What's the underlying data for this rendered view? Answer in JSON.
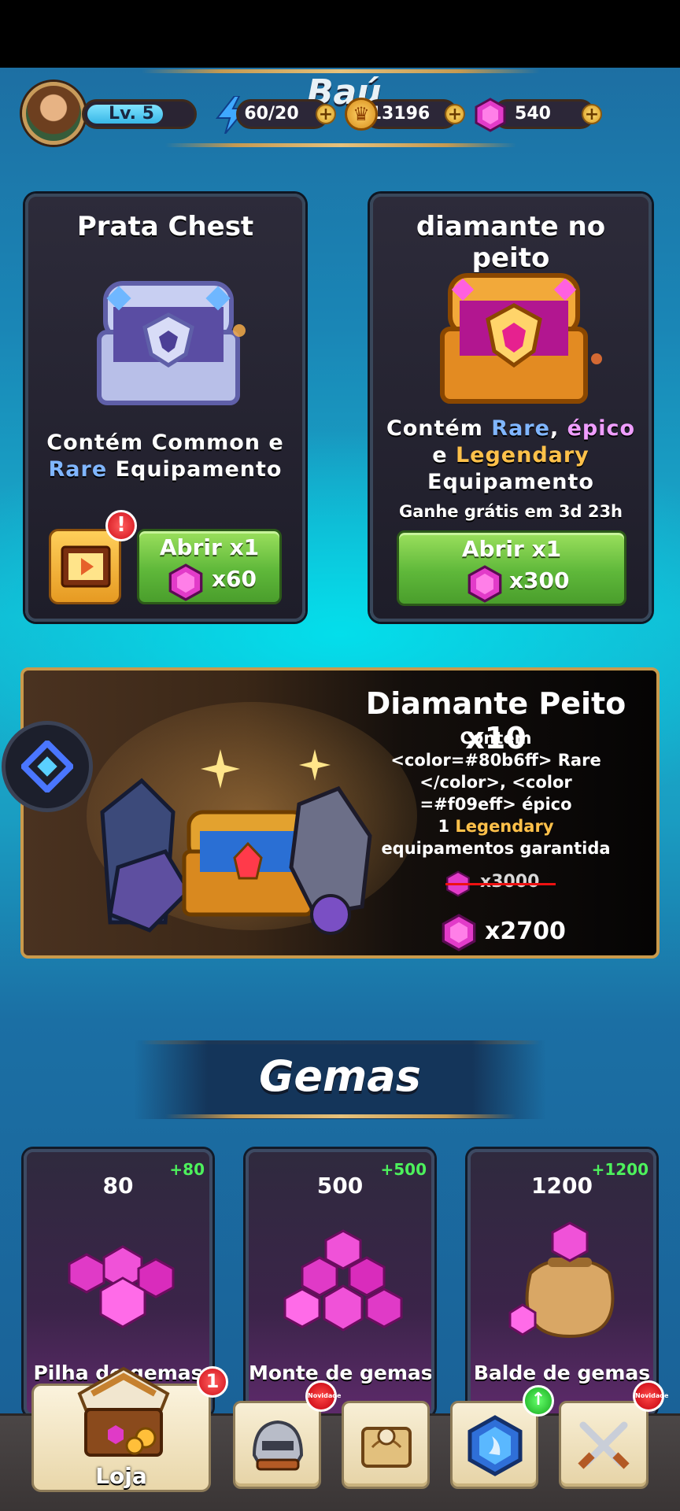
{
  "header": {
    "title": "Baú",
    "level": "Lv. 5",
    "energy": "60/20",
    "gold": "13196",
    "gems": "540",
    "plus": "+"
  },
  "silver_chest": {
    "title": "Prata Chest",
    "desc_contains": "Contém",
    "desc_common": "Common",
    "desc_and": "e",
    "desc_rare": "Rare",
    "desc_equip": "Equipamento",
    "open_label": "Abrir x1",
    "cost": "x60",
    "alert": "!"
  },
  "diamond_chest": {
    "title": "diamante no peito",
    "desc_contains": "Contém",
    "desc_rare": "Rare",
    "desc_comma": ",",
    "desc_epic": "épico",
    "desc_and": "e",
    "desc_legendary": "Legendary",
    "desc_equip": "Equipamento",
    "free_timer": "Ganhe grátis em 3d 23h",
    "open_label": "Abrir x1",
    "cost": "x300"
  },
  "promo": {
    "title": "Diamante Peito x10",
    "line1": "Contém",
    "line2": "<color=#80b6ff> Rare",
    "line3": "</color>, <color",
    "line4": "=#f09eff> épico",
    "line5_num": "1",
    "line5_legend": "Legendary",
    "line6": "equipamentos garantida",
    "old_price": "x3000",
    "price": "x2700"
  },
  "gems_section": {
    "title": "Gemas",
    "packs": [
      {
        "amount": "80",
        "bonus": "+80",
        "name": "Pilha de gemas"
      },
      {
        "amount": "500",
        "bonus": "+500",
        "name": "Monte de gemas"
      },
      {
        "amount": "1200",
        "bonus": "+1200",
        "name": "Balde de gemas"
      }
    ]
  },
  "bottom_nav": {
    "store_label": "Loja",
    "store_badge": "1",
    "new_badge": "Novidade",
    "up_badge": "↑"
  },
  "colors": {
    "rare": "#80b6ff",
    "epic": "#f09eff",
    "legendary": "#ffc14a",
    "bonus_green": "#4df15c"
  }
}
